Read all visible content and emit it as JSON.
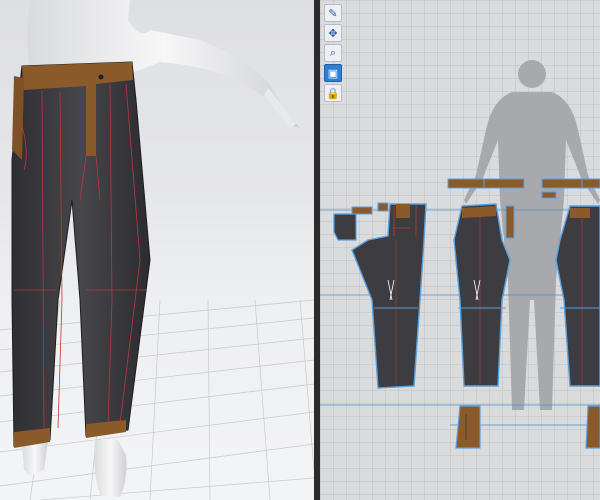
{
  "app": {
    "views": [
      "3d-garment-view",
      "2d-pattern-view"
    ]
  },
  "toolbar_2d": {
    "tools": [
      {
        "icon": "transform-tool-icon",
        "glyph": "✎"
      },
      {
        "icon": "edit-point-icon",
        "glyph": "✥"
      },
      {
        "icon": "zoom-icon",
        "glyph": "⌕"
      },
      {
        "icon": "texture-icon",
        "glyph": "▣"
      },
      {
        "icon": "lock-icon",
        "glyph": "🔒"
      }
    ]
  },
  "colors": {
    "fabric": "#3c3c41",
    "waistband": "#8a5a2a",
    "seam_red": "#c0363a",
    "pattern_outline": "#5aa0e0",
    "avatar_silhouette": "#a8a9ac"
  }
}
